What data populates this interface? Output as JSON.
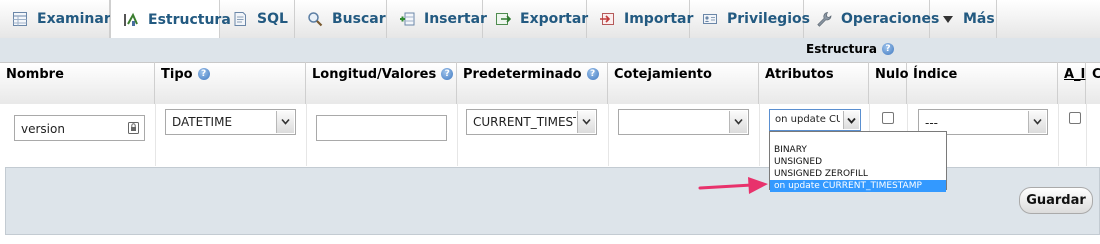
{
  "tabs": [
    {
      "label": "Examinar",
      "icon": "table-browse-icon",
      "active": false
    },
    {
      "label": "Estructura",
      "icon": "structure-icon",
      "active": true
    },
    {
      "label": "SQL",
      "icon": "sql-icon",
      "active": false
    },
    {
      "label": "Buscar",
      "icon": "search-icon",
      "active": false
    },
    {
      "label": "Insertar",
      "icon": "insert-icon",
      "active": false
    },
    {
      "label": "Exportar",
      "icon": "export-icon",
      "active": false
    },
    {
      "label": "Importar",
      "icon": "import-icon",
      "active": false
    },
    {
      "label": "Privilegios",
      "icon": "privileges-icon",
      "active": false
    },
    {
      "label": "Operaciones",
      "icon": "wrench-icon",
      "active": false
    },
    {
      "label": "Más",
      "icon": "triangle-down-icon",
      "active": false
    }
  ],
  "table": {
    "caption": "Estructura",
    "headers": {
      "nombre": "Nombre",
      "tipo": "Tipo",
      "longitud": "Longitud/Valores",
      "predeterminado": "Predeterminado",
      "cotejamiento": "Cotejamiento",
      "atributos": "Atributos",
      "nulo": "Nulo",
      "indice": "Índice",
      "ai": "A_I",
      "next": "C"
    },
    "row": {
      "nombre": "version",
      "tipo": "DATETIME",
      "longitud": "",
      "predeterminado": "CURRENT_TIMESTAMP",
      "cotejamiento": "",
      "atributos": "on update CURRENT_TIMESTAMP",
      "nulo": false,
      "indice": "---",
      "ai": false
    },
    "atributos_options": [
      "",
      "BINARY",
      "UNSIGNED",
      "UNSIGNED ZEROFILL",
      "on update CURRENT_TIMESTAMP"
    ],
    "atributos_selected_index": 4
  },
  "save_label": "Guardar",
  "colors": {
    "tab_text": "#235a81",
    "header_band": "#dde4ea",
    "selected_option": "#3399ff",
    "annotation_arrow": "#e8326c"
  }
}
